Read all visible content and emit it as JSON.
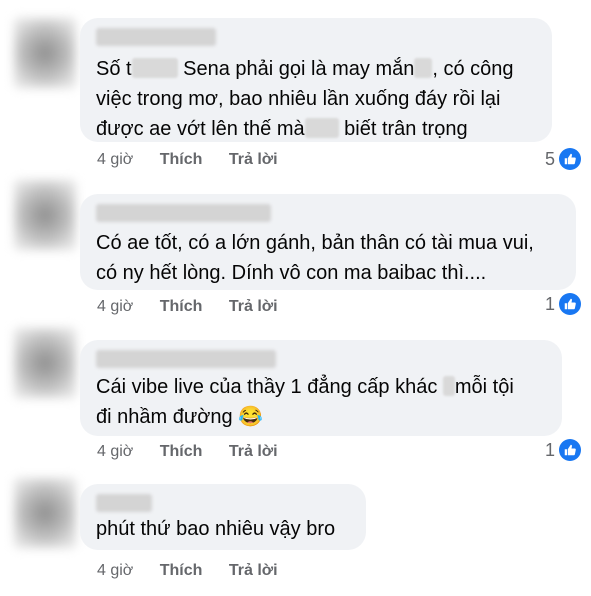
{
  "comments": [
    {
      "lines": [
        "Số t",
        " Sena phải gọi là may mắn",
        ", có công",
        "việc trong mơ, bao nhiêu lần xuống đáy rồi lại",
        "được ae vớt lên thế mà",
        " biết trân trọng"
      ],
      "time": "4 giờ",
      "like_label": "Thích",
      "reply_label": "Trả lời",
      "reactions": "5"
    },
    {
      "lines": [
        "Có ae tốt, có a lớn gánh, bản thân có tài mua vui,",
        "có ny hết lòng. Dính vô con ma baibac thì...."
      ],
      "time": "4 giờ",
      "like_label": "Thích",
      "reply_label": "Trả lời",
      "reactions": "1"
    },
    {
      "lines": [
        "Cái vibe live của thầy 1 đẳng cấp khác ",
        "mỗi tội",
        "đi nhầm đường "
      ],
      "emoji": "😂",
      "time": "4 giờ",
      "like_label": "Thích",
      "reply_label": "Trả lời",
      "reactions": "1"
    },
    {
      "lines": [
        "phút thứ bao nhiêu vậy bro"
      ],
      "time": "4 giờ",
      "like_label": "Thích",
      "reply_label": "Trả lời",
      "reactions": ""
    }
  ],
  "icons": {
    "reaction": "like-icon"
  },
  "colors": {
    "bubble": "#f0f2f5",
    "like_badge": "#1877f2",
    "meta_text": "#65676b"
  }
}
